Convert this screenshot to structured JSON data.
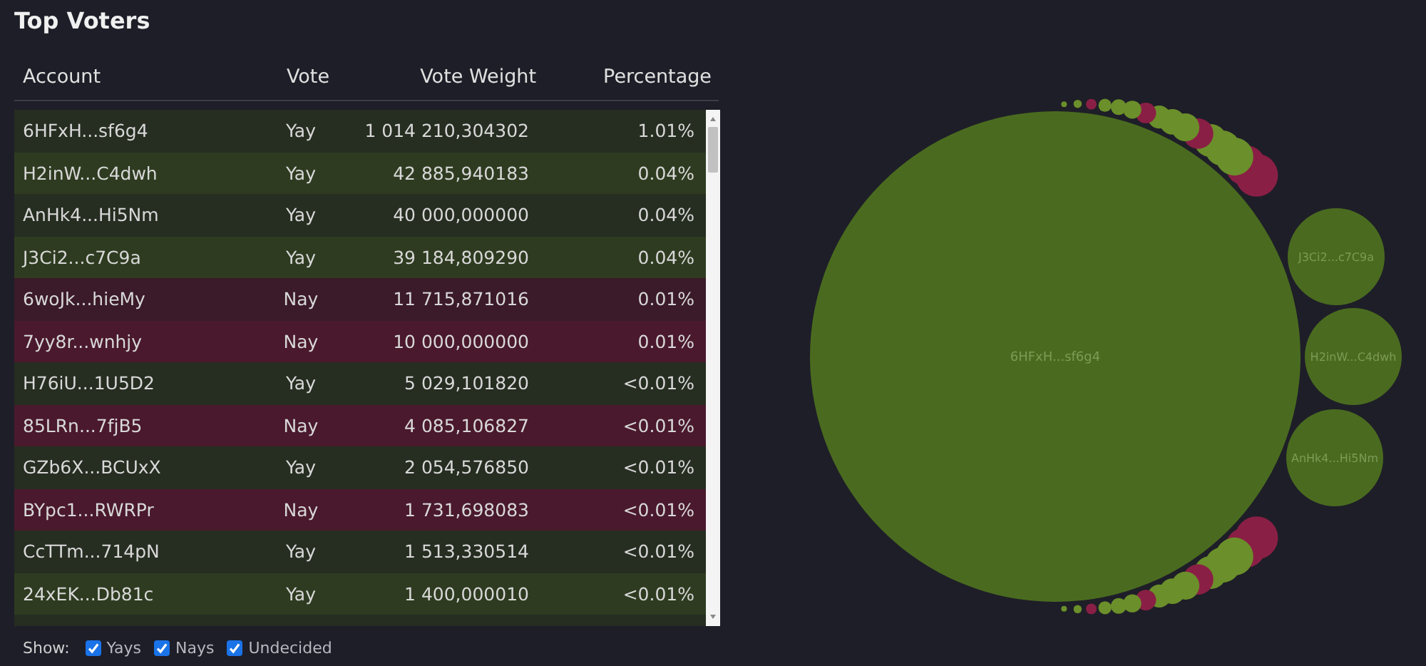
{
  "title": "Top Voters",
  "table": {
    "columns": [
      "Account",
      "Vote",
      "Vote Weight",
      "Percentage"
    ],
    "rows": [
      {
        "account": "6HFxH...sf6g4",
        "vote": "Yay",
        "weight": "1 014 210,304302",
        "percentage": "1.01%"
      },
      {
        "account": "H2inW...C4dwh",
        "vote": "Yay",
        "weight": "42 885,940183",
        "percentage": "0.04%"
      },
      {
        "account": "AnHk4...Hi5Nm",
        "vote": "Yay",
        "weight": "40 000,000000",
        "percentage": "0.04%"
      },
      {
        "account": "J3Ci2...c7C9a",
        "vote": "Yay",
        "weight": "39 184,809290",
        "percentage": "0.04%"
      },
      {
        "account": "6woJk...hieMy",
        "vote": "Nay",
        "weight": "11 715,871016",
        "percentage": "0.01%"
      },
      {
        "account": "7yy8r...wnhjy",
        "vote": "Nay",
        "weight": "10 000,000000",
        "percentage": "0.01%"
      },
      {
        "account": "H76iU...1U5D2",
        "vote": "Yay",
        "weight": "5 029,101820",
        "percentage": "<0.01%"
      },
      {
        "account": "85LRn...7fjB5",
        "vote": "Nay",
        "weight": "4 085,106827",
        "percentage": "<0.01%"
      },
      {
        "account": "GZb6X...BCUxX",
        "vote": "Yay",
        "weight": "2 054,576850",
        "percentage": "<0.01%"
      },
      {
        "account": "BYpc1...RWRPr",
        "vote": "Nay",
        "weight": "1 731,698083",
        "percentage": "<0.01%"
      },
      {
        "account": "CcTTm...714pN",
        "vote": "Yay",
        "weight": "1 513,330514",
        "percentage": "<0.01%"
      },
      {
        "account": "24xEK...Db81c",
        "vote": "Yay",
        "weight": "1 400,000010",
        "percentage": "<0.01%"
      }
    ]
  },
  "filters": {
    "label": "Show:",
    "options": [
      {
        "label": "Yays",
        "checked": true
      },
      {
        "label": "Nays",
        "checked": true
      },
      {
        "label": "Undecided",
        "checked": true
      }
    ]
  },
  "bubbles": [
    {
      "label": "6HFxH...sf6g4",
      "kind": "yay"
    },
    {
      "label": "J3Ci2...c7C9a",
      "kind": "yay"
    },
    {
      "label": "H2inW...C4dwh",
      "kind": "yay"
    },
    {
      "label": "AnHk4...Hi5Nm",
      "kind": "yay"
    }
  ]
}
